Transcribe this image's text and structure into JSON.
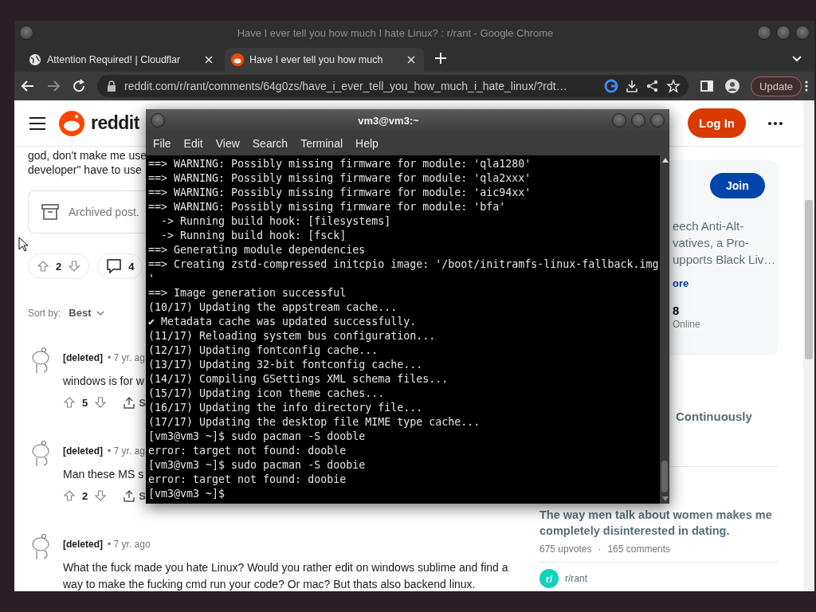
{
  "browser": {
    "title": "Have I ever tell you how much I hate Linux? : r/rant - Google Chrome",
    "tabs": [
      {
        "label": "Attention Required! | Cloudflar",
        "kind": "globe",
        "selected": false
      },
      {
        "label": "Have I ever tell you how much",
        "kind": "reddit",
        "selected": true
      }
    ],
    "url": "reddit.com/r/rant/comments/64g0zs/have_i_ever_tell_you_how_much_i_hate_linux/?rdt…",
    "update_button": "Update"
  },
  "reddit": {
    "logo": "reddit",
    "login": "Log In",
    "post_text": [
      "god, don't make me use",
      "developer\" have to use"
    ],
    "archived": "Archived post.",
    "votes": "2",
    "comment_count": "4",
    "sort_label": "Sort by:",
    "sort_value": "Best",
    "comments": [
      {
        "author": "[deleted]",
        "age": "• 7 yr. ag",
        "text": "windows is for w",
        "votes": "5",
        "share": "S"
      },
      {
        "author": "[deleted]",
        "age": "• 7 yr. ag",
        "text": "Man these MS s",
        "votes": "2",
        "share": "S"
      },
      {
        "author": "[deleted]",
        "age": "• 7 yr. ago",
        "text": "What the fuck made you hate Linux? Would you rather edit on windows sublime and find a way to make the fucking cmd run your code? Or mac? But thats also backend linux."
      }
    ],
    "sidebar": {
      "join": "Join",
      "description": [
        "eech Anti-Alt-",
        "vatives, a Pro-",
        "upports Black Liv…"
      ],
      "more_link": "ore",
      "online_count": "8",
      "online_label": "Online",
      "related_title": "Continuously",
      "post": {
        "title": "The way men talk about women makes me completely disinterested in dating.",
        "upvotes": "675 upvotes",
        "separator": "·",
        "comments": "165 comments"
      },
      "community": {
        "avatar": "r/",
        "name": "r/rant"
      }
    }
  },
  "terminal": {
    "title": "vm3@vm3:~",
    "menu": [
      "File",
      "Edit",
      "View",
      "Search",
      "Terminal",
      "Help"
    ],
    "lines": [
      "==> WARNING: Possibly missing firmware for module: 'qla1280'",
      "==> WARNING: Possibly missing firmware for module: 'qla2xxx'",
      "==> WARNING: Possibly missing firmware for module: 'aic94xx'",
      "==> WARNING: Possibly missing firmware for module: 'bfa'",
      "  -> Running build hook: [filesystems]",
      "  -> Running build hook: [fsck]",
      "==> Generating module dependencies",
      "==> Creating zstd-compressed initcpio image: '/boot/initramfs-linux-fallback.img",
      "'",
      "==> Image generation successful",
      "(10/17) Updating the appstream cache...",
      "✔ Metadata cache was updated successfully.",
      "(11/17) Reloading system bus configuration...",
      "(12/17) Updating fontconfig cache...",
      "(13/17) Updating 32-bit fontconfig cache...",
      "(14/17) Compiling GSettings XML schema files...",
      "(15/17) Updating icon theme caches...",
      "(16/17) Updating the info directory file...",
      "(17/17) Updating the desktop file MIME type cache...",
      "[vm3@vm3 ~]$ sudo pacman -S dooble",
      "error: target not found: dooble",
      "[vm3@vm3 ~]$ sudo pacman -S doobie",
      "error: target not found: doobie",
      "[vm3@vm3 ~]$"
    ]
  }
}
